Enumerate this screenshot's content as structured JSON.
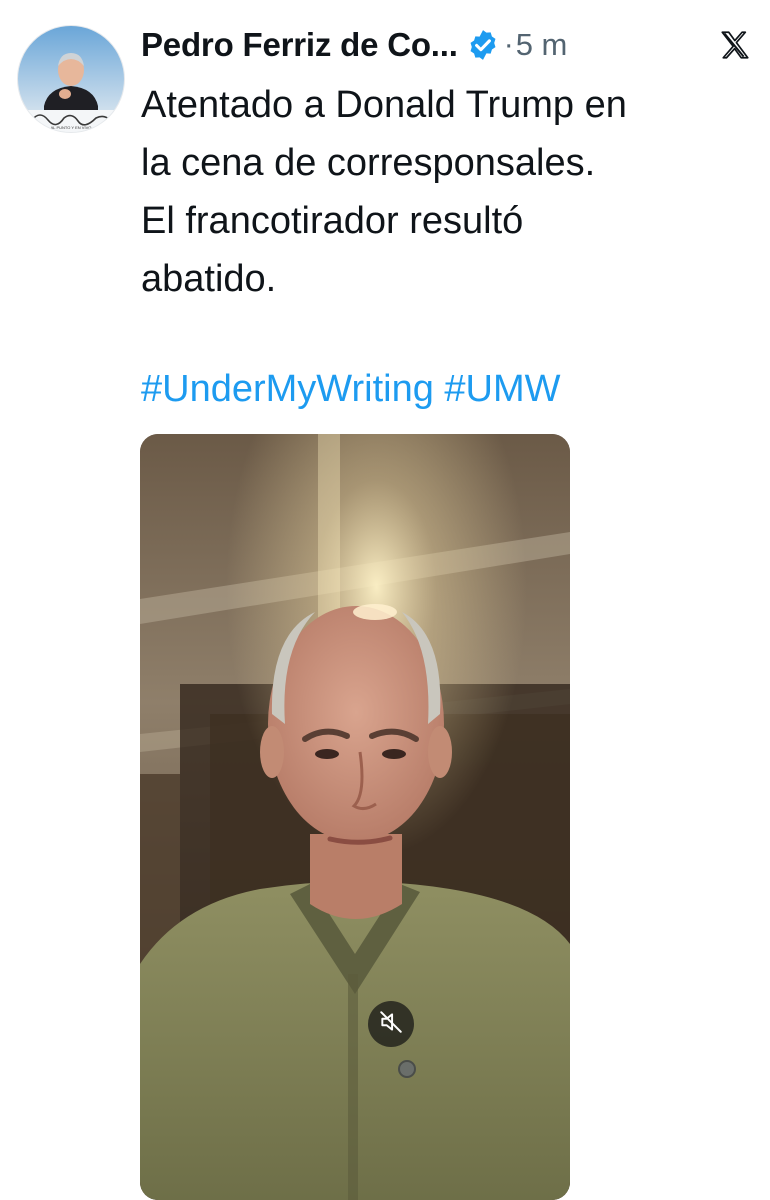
{
  "author": {
    "name": "Pedro Ferriz de Co...",
    "verified": true,
    "avatar_icon": "profile-photo",
    "avatar_caption": "AL PUNTO Y EN VIVO"
  },
  "meta": {
    "separator": "·",
    "timestamp": "5 m"
  },
  "platform": {
    "logo_icon": "x-logo-icon"
  },
  "post": {
    "lines": [
      "Atentado a Donald Trump en",
      "la cena de corresponsales.",
      "El francotirador resultó",
      "abatido."
    ],
    "hashtags": [
      "#UnderMyWriting",
      "#UMW"
    ]
  },
  "media": {
    "type": "video",
    "muted": true,
    "mute_icon": "speaker-muted-icon"
  },
  "colors": {
    "text": "#0f1419",
    "secondary": "#536471",
    "link": "#1d9bf0",
    "verified": "#1d9bf0"
  }
}
